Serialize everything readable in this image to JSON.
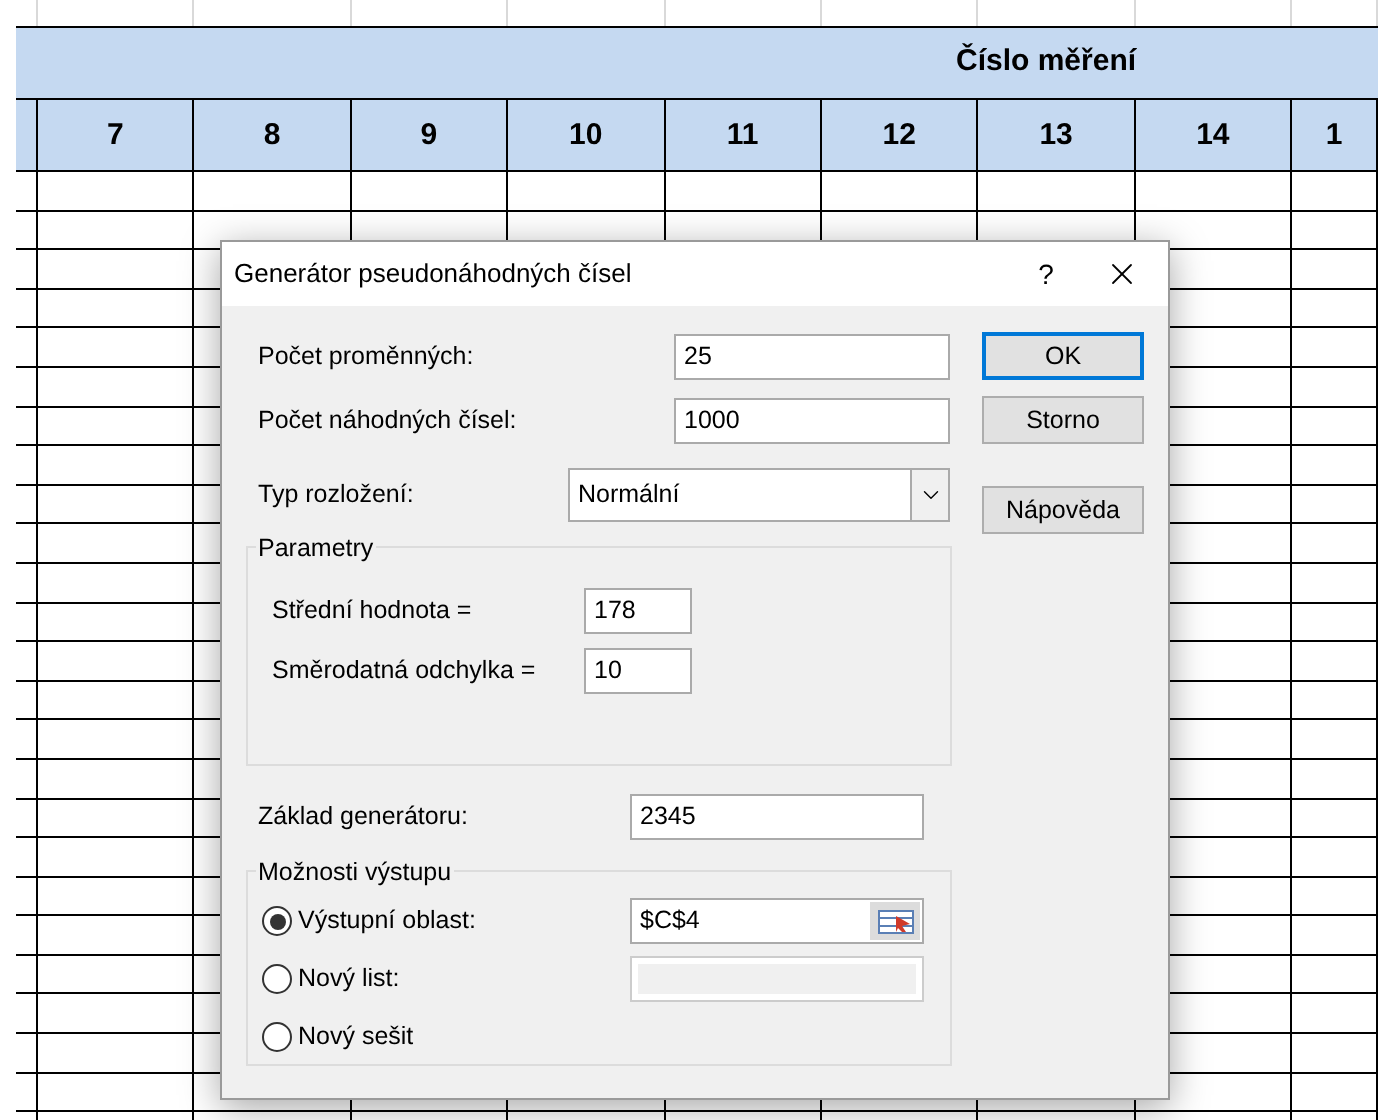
{
  "sheet": {
    "group_header": "Číslo měření",
    "columns": [
      "7",
      "8",
      "9",
      "10",
      "11",
      "12",
      "13",
      "14",
      "1"
    ]
  },
  "dialog": {
    "title": "Generátor pseudonáhodných čísel",
    "help": "?",
    "fields": [
      {
        "label": "Počet proměnných:",
        "value": "25"
      },
      {
        "label": "Počet náhodných čísel:",
        "value": "1000"
      }
    ],
    "distribution": {
      "label": "Typ rozložení:",
      "value": "Normální"
    },
    "parameters": {
      "title": "Parametry",
      "fields": [
        {
          "label": "Střední hodnota =",
          "value": "178"
        },
        {
          "label": "Směrodatná odchylka =",
          "value": "10"
        }
      ]
    },
    "seed": {
      "label": "Základ generátoru:",
      "value": "2345"
    },
    "output": {
      "title": "Možnosti výstupu",
      "options": [
        {
          "label": "Výstupní oblast:",
          "selected": true,
          "kind": "range",
          "value": "$C$4"
        },
        {
          "label": "Nový list:",
          "selected": false,
          "kind": "disabled-field"
        },
        {
          "label": "Nový sešit",
          "selected": false,
          "kind": "none"
        }
      ]
    },
    "buttons": [
      {
        "label": "OK",
        "default": true
      },
      {
        "label": "Storno",
        "default": false
      },
      {
        "label": "Nápověda",
        "default": false
      }
    ]
  }
}
